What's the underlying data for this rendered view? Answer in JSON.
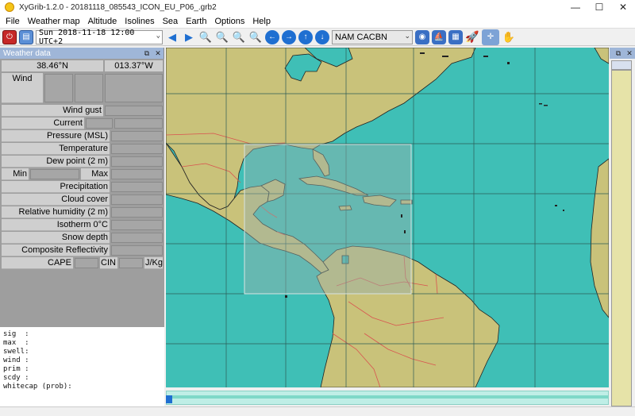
{
  "window": {
    "title": "XyGrib-1.2.0 - 20181118_085543_ICON_EU_P06_.grb2",
    "minimize": "—",
    "maximize": "☐",
    "close": "✕"
  },
  "menu": [
    "File",
    "Weather map",
    "Altitude",
    "Isolines",
    "Sea",
    "Earth",
    "Options",
    "Help"
  ],
  "toolbar": {
    "date_value": "Sun 2018-11-18 12:00 UTC+2",
    "model_value": "NAM CACBN"
  },
  "panel": {
    "title": "Weather data",
    "lat": "38.46°N",
    "lon": "013.37°W",
    "labels": {
      "wind": "Wind",
      "wind_gust": "Wind gust",
      "current": "Current",
      "pressure": "Pressure (MSL)",
      "temperature": "Temperature",
      "dew_point": "Dew point (2 m)",
      "min": "Min",
      "max": "Max",
      "precipitation": "Precipitation",
      "cloud_cover": "Cloud cover",
      "rel_humidity": "Relative humidity (2 m)",
      "isotherm": "Isotherm 0°C",
      "snow_depth": "Snow depth",
      "composite": "Composite Reflectivity",
      "cape": "CAPE",
      "cin": "CIN",
      "jkg": "J/Kg"
    },
    "mono_lines": [
      "sig  :",
      "max  :",
      "swell:",
      "wind :",
      "prim :",
      "scdy :",
      "whitecap (prob):"
    ]
  },
  "colors": {
    "sea": "#3fbfb6",
    "land": "#c9c27a",
    "border": "#d9534f",
    "grid": "#2b5b56",
    "highlight": "#7aa7a0"
  }
}
